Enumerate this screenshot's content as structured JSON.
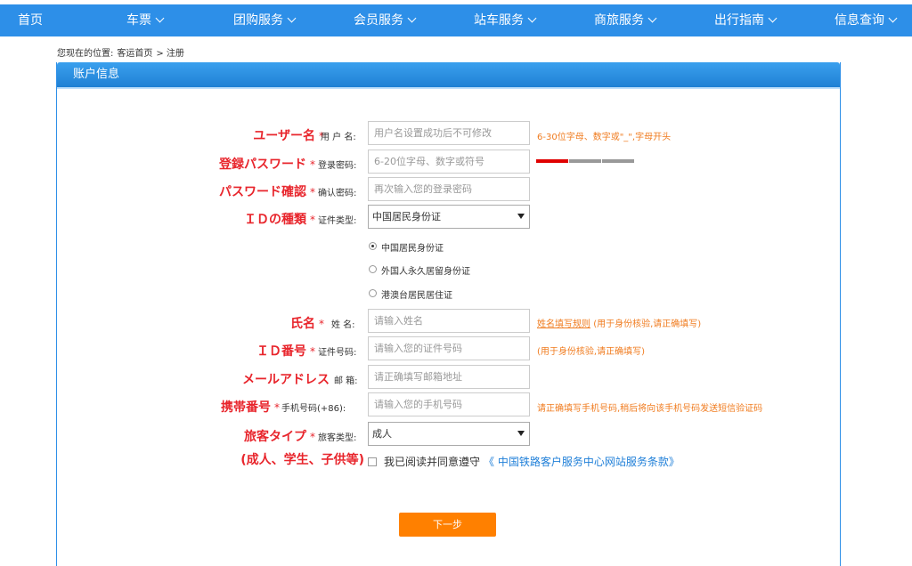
{
  "nav": {
    "items": [
      {
        "label": "首页",
        "dropdown": false
      },
      {
        "label": "车票",
        "dropdown": true
      },
      {
        "label": "团购服务",
        "dropdown": true
      },
      {
        "label": "会员服务",
        "dropdown": true
      },
      {
        "label": "站车服务",
        "dropdown": true
      },
      {
        "label": "商旅服务",
        "dropdown": true
      },
      {
        "label": "出行指南",
        "dropdown": true
      },
      {
        "label": "信息查询",
        "dropdown": true
      }
    ]
  },
  "breadcrumb": {
    "prefix": "您现在的位置:",
    "home": "客运首页",
    "current": "> 注册"
  },
  "panel": {
    "title": "账户信息"
  },
  "form": {
    "username": {
      "jp": "ユーザー名",
      "cn": "用 户 名:",
      "placeholder": "用户名设置成功后不可修改",
      "hint": "6-30位字母、数字或\"_\",字母开头"
    },
    "password": {
      "jp": "登録パスワード",
      "cn": "登录密码:",
      "placeholder": "6-20位字母、数字或符号"
    },
    "confirm": {
      "jp": "パスワード確認",
      "cn": "确认密码:",
      "placeholder": "再次输入您的登录密码"
    },
    "id_type": {
      "jp": "ＩＤの種類",
      "cn": "证件类型:",
      "selected": "中国居民身份证",
      "options": [
        "中国居民身份证",
        "外国人永久居留身份证",
        "港澳台居民居住证"
      ]
    },
    "name": {
      "jp": "氏名",
      "cn": "姓 名:",
      "placeholder": "请输入姓名",
      "hint_link": "姓名填写规则",
      "hint": "(用于身份核验,请正确填写)"
    },
    "id_number": {
      "jp": "ＩＤ番号",
      "cn": "证件号码:",
      "placeholder": "请输入您的证件号码",
      "hint": "(用于身份核验,请正确填写)"
    },
    "email": {
      "jp": "メールアドレス",
      "cn": "邮 箱:",
      "placeholder": "请正确填写邮箱地址"
    },
    "mobile": {
      "jp": "携帯番号",
      "cn": "手机号码(+86):",
      "placeholder": "请输入您的手机号码",
      "hint": "请正确填写手机号码,稍后将向该手机号码发送短信验证码"
    },
    "passenger_type": {
      "jp": "旅客タイプ",
      "cn": "旅客类型:",
      "selected": "成人",
      "note": "(成人、学生、子供等)"
    },
    "star": "*",
    "agree_text": "我已阅读并同意遵守",
    "agree_link": "《 中国铁路客户服务中心网站服务条款》",
    "next_label": "下一步"
  },
  "colors": {
    "nav_bg": "#2d8fe8",
    "jp_label": "#e8252c",
    "hint": "#f07c20",
    "button": "#ff8000",
    "link": "#1f7fd8",
    "strength_active": "#e00000",
    "strength_inactive": "#999999"
  },
  "password_strength": {
    "segments": 3,
    "active": 1
  }
}
